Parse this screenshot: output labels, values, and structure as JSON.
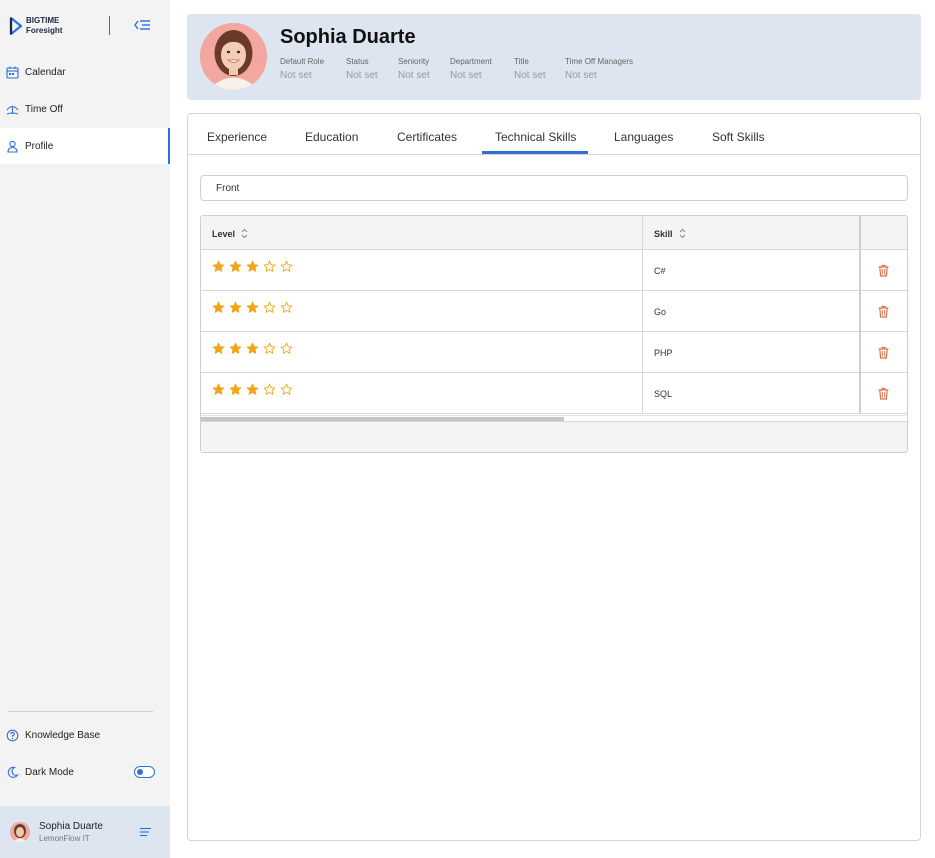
{
  "sidebar": {
    "brand_line1": "BIGTIME",
    "brand_line2": "Foresight",
    "nav": [
      {
        "label": "Calendar",
        "icon": "calendar-icon"
      },
      {
        "label": "Time Off",
        "icon": "time-off-icon"
      },
      {
        "label": "Profile",
        "icon": "person-icon",
        "active": true
      }
    ],
    "knowledge_base": "Knowledge Base",
    "dark_mode": "Dark Mode",
    "dark_mode_on": true,
    "user": {
      "name": "Sophia Duarte",
      "company": "LemonFlow IT"
    }
  },
  "profile": {
    "name": "Sophia Duarte",
    "fields": [
      {
        "label": "Default Role",
        "value": "Not set"
      },
      {
        "label": "Status",
        "value": "Not set"
      },
      {
        "label": "Seniority",
        "value": "Not set"
      },
      {
        "label": "Department",
        "value": "Not set"
      },
      {
        "label": "Title",
        "value": "Not set"
      },
      {
        "label": "Time Off Managers",
        "value": "Not set"
      }
    ]
  },
  "tabs": [
    "Experience",
    "Education",
    "Certificates",
    "Technical Skills",
    "Languages",
    "Soft Skills"
  ],
  "active_tab": "Technical Skills",
  "filter": {
    "value": "Front"
  },
  "grid": {
    "headers": {
      "level": "Level",
      "skill": "Skill"
    },
    "rows": [
      {
        "level": 3,
        "max_level": 5,
        "skill": "C#"
      },
      {
        "level": 3,
        "max_level": 5,
        "skill": "Go"
      },
      {
        "level": 3,
        "max_level": 5,
        "skill": "PHP"
      },
      {
        "level": 3,
        "max_level": 5,
        "skill": "SQL"
      }
    ]
  },
  "colors": {
    "accent": "#2e6fd8",
    "star": "#f2a516",
    "delete": "#d9744a",
    "header_bg": "#dde5f0",
    "sidebar_bg": "#f3f3f3"
  }
}
